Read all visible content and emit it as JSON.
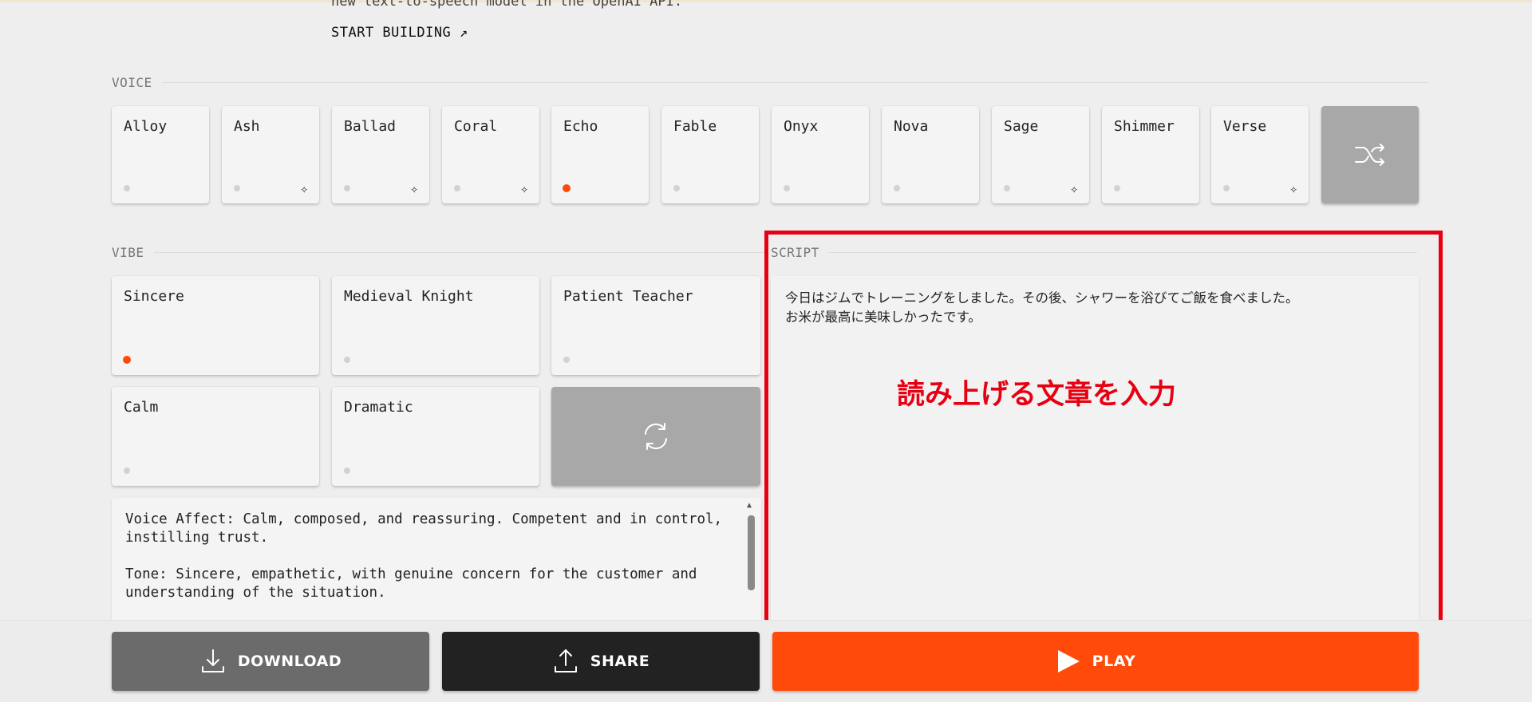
{
  "header": {
    "tagline": "new text-to-speech model in the OpenAI API.",
    "start_building": "START BUILDING ↗"
  },
  "voice": {
    "label": "VOICE",
    "options": [
      {
        "name": "Alloy",
        "selected": false,
        "sparkle": false
      },
      {
        "name": "Ash",
        "selected": false,
        "sparkle": true
      },
      {
        "name": "Ballad",
        "selected": false,
        "sparkle": true
      },
      {
        "name": "Coral",
        "selected": false,
        "sparkle": true
      },
      {
        "name": "Echo",
        "selected": true,
        "sparkle": false
      },
      {
        "name": "Fable",
        "selected": false,
        "sparkle": false
      },
      {
        "name": "Onyx",
        "selected": false,
        "sparkle": false
      },
      {
        "name": "Nova",
        "selected": false,
        "sparkle": false
      },
      {
        "name": "Sage",
        "selected": false,
        "sparkle": true
      },
      {
        "name": "Shimmer",
        "selected": false,
        "sparkle": false
      },
      {
        "name": "Verse",
        "selected": false,
        "sparkle": true
      }
    ],
    "shuffle_icon": "shuffle-icon"
  },
  "vibe": {
    "label": "VIBE",
    "options": [
      {
        "name": "Sincere",
        "selected": true
      },
      {
        "name": "Medieval Knight",
        "selected": false
      },
      {
        "name": "Patient Teacher",
        "selected": false
      },
      {
        "name": "Calm",
        "selected": false
      },
      {
        "name": "Dramatic",
        "selected": false
      }
    ],
    "refresh_icon": "refresh-icon",
    "description": [
      "Voice Affect: Calm, composed, and reassuring. Competent and in control, instilling trust.",
      "Tone: Sincere, empathetic, with genuine concern for the customer and understanding of the situation."
    ]
  },
  "script": {
    "label": "SCRIPT",
    "lines": [
      "今日はジムでトレーニングをしました。その後、シャワーを浴びてご飯を食べました。",
      "お米が最高に美味しかったです。"
    ]
  },
  "annotation": {
    "text": "読み上げる文章を入力",
    "color": "#e60012"
  },
  "actions": {
    "download": "DOWNLOAD",
    "share": "SHARE",
    "play": "PLAY"
  },
  "colors": {
    "accent": "#ff4a0a",
    "background": "#eeeeee",
    "download_button": "#6b6b6b",
    "share_button": "#222222"
  }
}
